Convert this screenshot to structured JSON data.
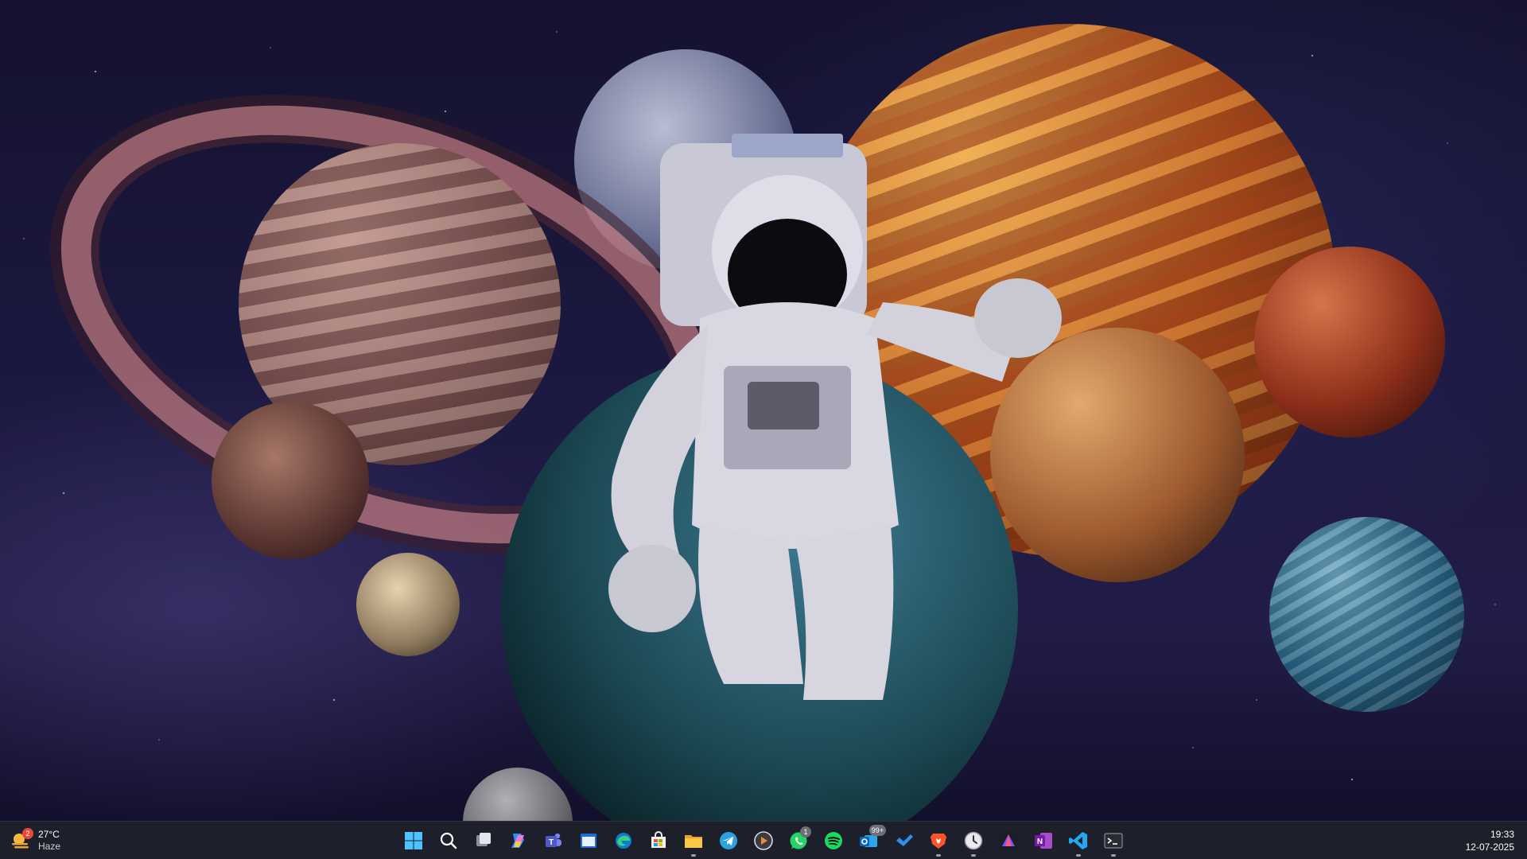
{
  "wallpaper": {
    "description_icon": "space-astronaut-wallpaper"
  },
  "weather": {
    "temperature": "27°C",
    "condition": "Haze",
    "badge": "2",
    "icon": "sun-haze-icon"
  },
  "taskbar": {
    "apps": [
      {
        "name": "start-button",
        "icon": "windows-logo-icon",
        "badge": "",
        "running": false
      },
      {
        "name": "search-button",
        "icon": "search-icon",
        "badge": "",
        "running": false
      },
      {
        "name": "task-view-button",
        "icon": "task-view-icon",
        "badge": "",
        "running": false
      },
      {
        "name": "copilot-button",
        "icon": "copilot-icon",
        "badge": "",
        "running": false
      },
      {
        "name": "teams-button",
        "icon": "teams-icon",
        "badge": "",
        "running": false
      },
      {
        "name": "widgets-button",
        "icon": "window-icon",
        "badge": "",
        "running": false
      },
      {
        "name": "edge-button",
        "icon": "edge-icon",
        "badge": "",
        "running": false
      },
      {
        "name": "store-button",
        "icon": "store-icon",
        "badge": "",
        "running": false
      },
      {
        "name": "file-explorer-button",
        "icon": "folder-icon",
        "badge": "",
        "running": true
      },
      {
        "name": "telegram-button",
        "icon": "telegram-icon",
        "badge": "",
        "running": false
      },
      {
        "name": "media-player-button",
        "icon": "play-icon",
        "badge": "",
        "running": false
      },
      {
        "name": "whatsapp-button",
        "icon": "whatsapp-icon",
        "badge": "1",
        "running": false
      },
      {
        "name": "spotify-button",
        "icon": "spotify-icon",
        "badge": "",
        "running": false
      },
      {
        "name": "outlook-button",
        "icon": "mail-icon",
        "badge": "99+",
        "running": false
      },
      {
        "name": "todo-button",
        "icon": "checkmark-icon",
        "badge": "",
        "running": false
      },
      {
        "name": "brave-button",
        "icon": "brave-icon",
        "badge": "",
        "running": true
      },
      {
        "name": "clock-app-button",
        "icon": "clock-icon",
        "badge": "",
        "running": true
      },
      {
        "name": "affinity-button",
        "icon": "affinity-icon",
        "badge": "",
        "running": false
      },
      {
        "name": "onenote-button",
        "icon": "onenote-icon",
        "badge": "",
        "running": false
      },
      {
        "name": "vscode-button",
        "icon": "vscode-icon",
        "badge": "",
        "running": true
      },
      {
        "name": "terminal-button",
        "icon": "terminal-icon",
        "badge": "",
        "running": true
      }
    ]
  },
  "clock": {
    "time": "19:33",
    "date": "12-07-2025"
  }
}
